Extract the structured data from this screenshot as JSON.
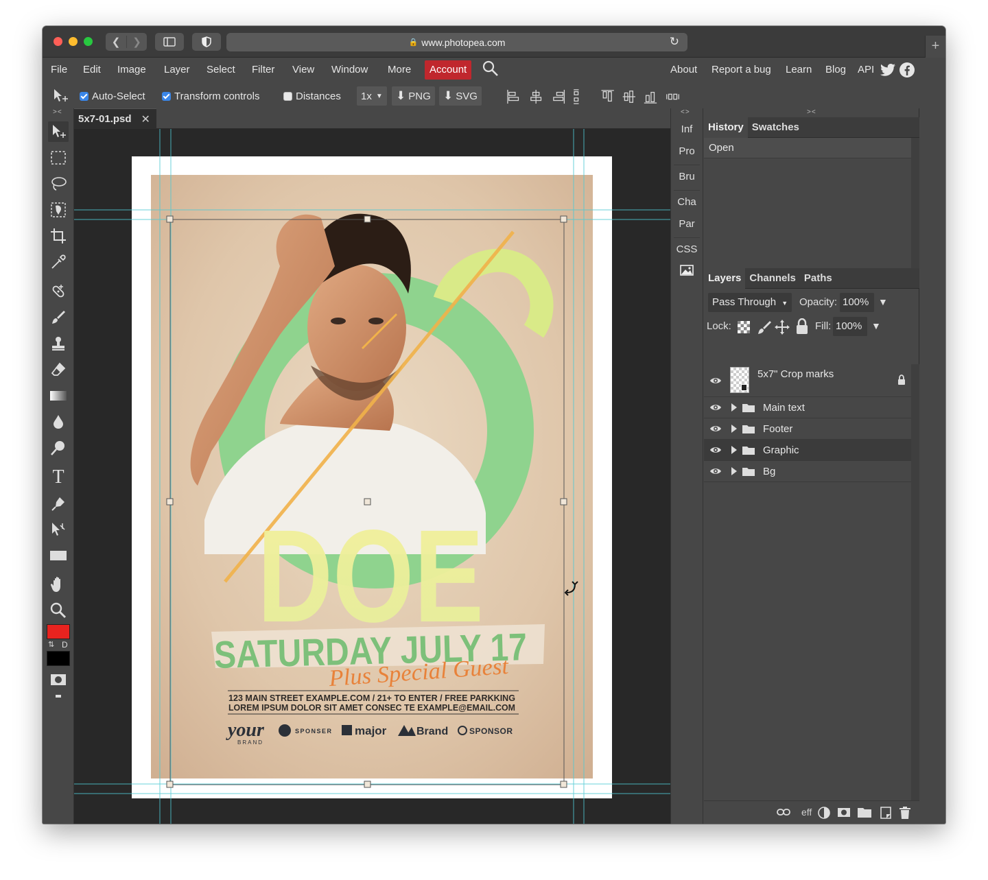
{
  "browser": {
    "url": "www.photopea.com"
  },
  "menu": {
    "items": [
      "File",
      "Edit",
      "Image",
      "Layer",
      "Select",
      "Filter",
      "View",
      "Window",
      "More"
    ],
    "account": "Account",
    "right_items": [
      "About",
      "Report a bug",
      "Learn",
      "Blog",
      "API"
    ]
  },
  "options": {
    "auto_select": "Auto-Select",
    "transform_controls": "Transform controls",
    "distances": "Distances",
    "scale": "1x",
    "png": "PNG",
    "svg": "SVG"
  },
  "document": {
    "tab_name": "5x7-01.psd"
  },
  "mini_panel": {
    "items": [
      "Inf",
      "Pro",
      "Bru",
      "Cha",
      "Par",
      "CSS"
    ]
  },
  "panels": {
    "history_tabs": [
      "History",
      "Swatches"
    ],
    "history_items": [
      "Open"
    ],
    "layer_tabs": [
      "Layers",
      "Channels",
      "Paths"
    ],
    "blend_mode": "Pass Through",
    "opacity_label": "Opacity:",
    "opacity_value": "100%",
    "lock_label": "Lock:",
    "fill_label": "Fill:",
    "fill_value": "100%",
    "layers": [
      {
        "name": "5x7\" Crop marks",
        "type": "layer",
        "locked": true
      },
      {
        "name": "Main text",
        "type": "group"
      },
      {
        "name": "Footer",
        "type": "group"
      },
      {
        "name": "Graphic",
        "type": "group",
        "selected": true
      },
      {
        "name": "Bg",
        "type": "group"
      }
    ],
    "bottom_icons": [
      "link-icon",
      "eff",
      "adjustment-icon",
      "mask-icon",
      "folder-icon",
      "new-layer-icon",
      "trash-icon"
    ],
    "eff_label": "eff"
  },
  "poster": {
    "headline": "DOE",
    "date": "SATURDAY JULY 17",
    "tagline": "Plus Special Guest",
    "info_line1": "123 MAIN STREET EXAMPLE.COM / 21+ TO ENTER  /  FREE PARKKING",
    "info_line2": "LOREM IPSUM DOLOR SIT AMET CONSEC TE   EXAMPLE@EMAIL.COM",
    "logos": {
      "your": "your",
      "your_sub": "BRAND",
      "sponser": "SPONSER",
      "major": "major",
      "brand": "Brand",
      "sponsor": "SPONSOR"
    }
  },
  "colors": {
    "foreground": "#e8231f",
    "background": "#000000",
    "account": "#c0272d",
    "guide": "#4ec9d4"
  },
  "toolbox": {
    "swap_label": "D"
  }
}
